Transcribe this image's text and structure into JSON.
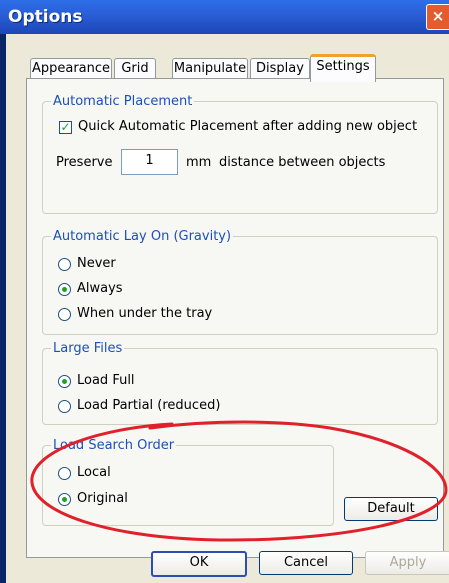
{
  "window": {
    "title": "Options",
    "close_label": "×"
  },
  "tabs": [
    {
      "label": "Appearance"
    },
    {
      "label": "Grid"
    },
    {
      "label": "Manipulate"
    },
    {
      "label": "Display"
    },
    {
      "label": "Settings"
    }
  ],
  "automatic_placement": {
    "legend": "Automatic Placement",
    "checkbox_label": "Quick Automatic Placement after adding new object",
    "checkbox_checked": true,
    "preserve_label": "Preserve",
    "preserve_value": "1",
    "unit_label": "mm",
    "distance_label": "distance between objects"
  },
  "gravity": {
    "legend": "Automatic Lay On (Gravity)",
    "options": [
      "Never",
      "Always",
      "When under the tray"
    ],
    "selected": "Always"
  },
  "large_files": {
    "legend": "Large Files",
    "options": [
      "Load Full",
      "Load Partial (reduced)"
    ],
    "selected": "Load Full"
  },
  "load_search_order": {
    "legend": "Load Search Order",
    "options": [
      "Local",
      "Original"
    ],
    "selected": "Original"
  },
  "buttons": {
    "default_label": "Default",
    "ok_label": "OK",
    "cancel_label": "Cancel",
    "apply_label": "Apply"
  },
  "colors": {
    "title_bar": "#2a5fd7",
    "annotation": "#e0202a",
    "radio_selected": "#21a121"
  }
}
